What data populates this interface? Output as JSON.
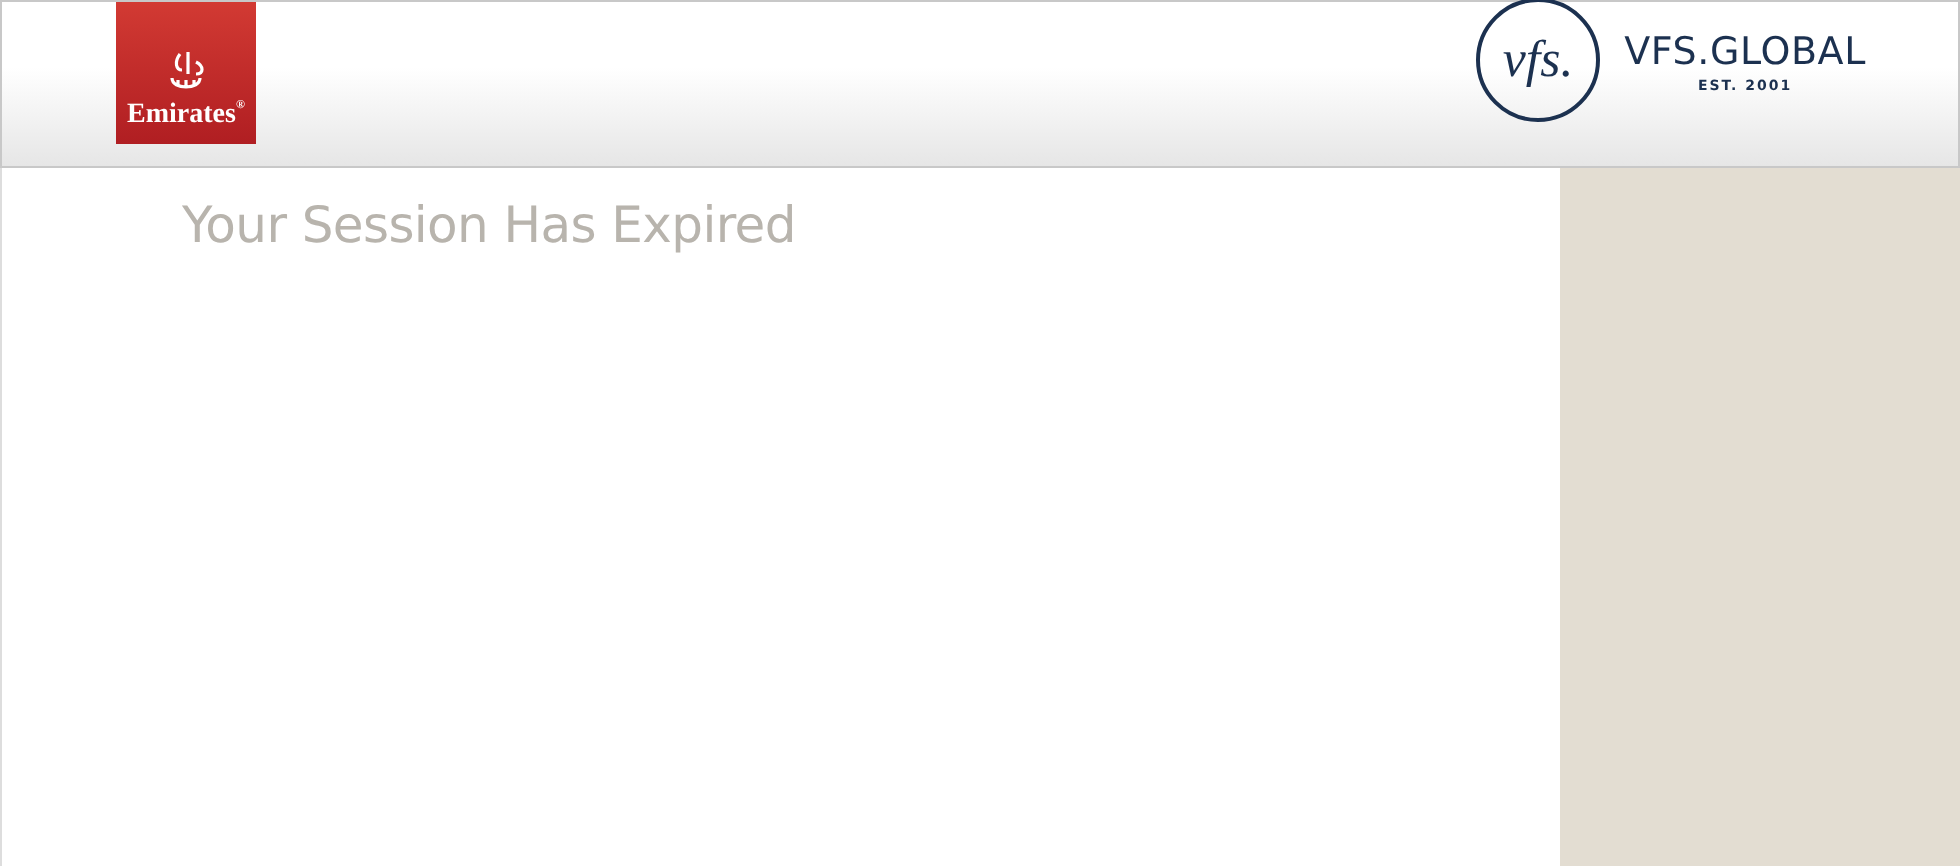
{
  "header": {
    "airline_logo": {
      "name": "Emirates",
      "mark": "®"
    },
    "partner_logo": {
      "monogram": "vfs.",
      "name": "VFS.GLOBAL",
      "tagline": "EST. 2001"
    }
  },
  "main": {
    "title": "Your Session Has Expired"
  }
}
